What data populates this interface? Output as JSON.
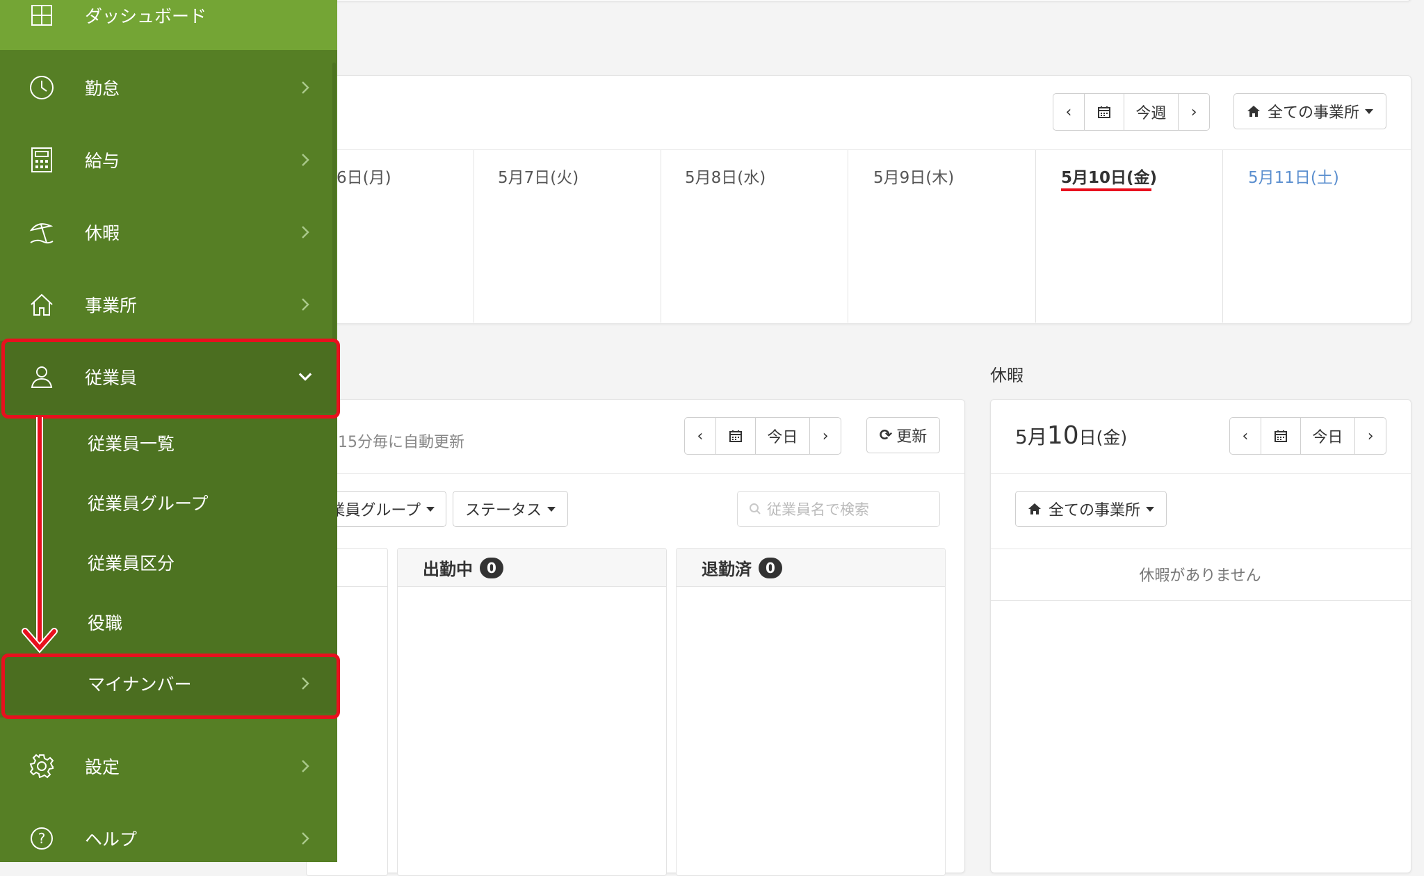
{
  "colors": {
    "sidebar": "#567f25",
    "sidebar_active": "#4b6e20",
    "sidebar_top": "#74a535",
    "highlight": "#e8101e",
    "today_underline": "#e8101e",
    "saturday": "#5b8fcf"
  },
  "sidebar": {
    "items": [
      {
        "key": "dashboard",
        "label": "ダッシュボード",
        "icon": "dashboard-icon"
      },
      {
        "key": "attendance",
        "label": "勤怠",
        "icon": "clock-icon"
      },
      {
        "key": "payroll",
        "label": "給与",
        "icon": "calculator-icon"
      },
      {
        "key": "leave",
        "label": "休暇",
        "icon": "beach-umbrella-icon"
      },
      {
        "key": "office",
        "label": "事業所",
        "icon": "home-icon"
      },
      {
        "key": "employee",
        "label": "従業員",
        "icon": "user-icon"
      },
      {
        "key": "settings",
        "label": "設定",
        "icon": "gear-icon"
      },
      {
        "key": "help",
        "label": "ヘルプ",
        "icon": "help-icon"
      }
    ],
    "employee_sub": [
      "従業員一覧",
      "従業員グループ",
      "従業員区分",
      "役職",
      "マイナンバー"
    ]
  },
  "week": {
    "today_label": "今週",
    "office_filter": "全ての事業所",
    "days": [
      "6日(月)",
      "5月7日(火)",
      "5月8日(水)",
      "5月9日(木)",
      "5月10日(金)",
      "5月11日(土)"
    ]
  },
  "attendance": {
    "auto_update": "15分毎に自動更新",
    "today_label": "今日",
    "refresh_label": "更新",
    "group_filter": "業員グループ",
    "status_filter": "ステータス",
    "search_placeholder": "従業員名で検索",
    "columns": [
      {
        "label": "出勤中",
        "count": "0"
      },
      {
        "label": "退勤済",
        "count": "0"
      }
    ]
  },
  "leave": {
    "section_title": "休暇",
    "date_month": "5月",
    "date_day": "10",
    "date_suffix": "日(金)",
    "today_label": "今日",
    "office_filter": "全ての事業所",
    "empty_message": "休暇がありません"
  }
}
